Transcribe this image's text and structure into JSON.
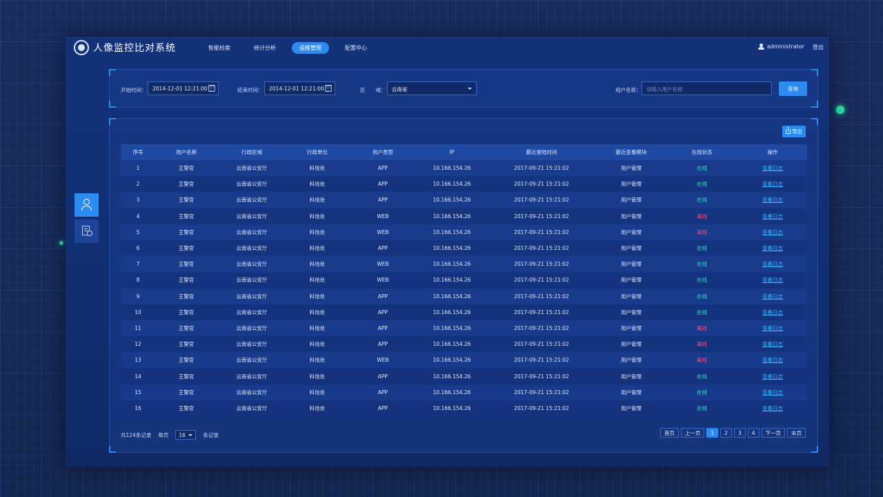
{
  "app": {
    "title": "人像监控比对系统"
  },
  "nav": {
    "items": [
      {
        "label": "智能检索",
        "active": false
      },
      {
        "label": "统计分析",
        "active": false
      },
      {
        "label": "运维管理",
        "active": true
      },
      {
        "label": "配置中心",
        "active": false
      }
    ]
  },
  "user": {
    "name": "administrator",
    "logout_label": "登出"
  },
  "filters": {
    "start_label": "开始时间：",
    "start_value": "2014-12-01  12:21:00",
    "end_label": "结束时间：",
    "end_value": "2014-12-01  12:21:00",
    "region_label": "区　　域：",
    "region_value": "云南省",
    "username_label": "用户名称：",
    "username_placeholder": "请输入用户名称",
    "query_label": "查询"
  },
  "table": {
    "export_label": "导出",
    "columns": [
      "序号",
      "用户名称",
      "行政区域",
      "行政单位",
      "用户类型",
      "IP",
      "最近登陆时间",
      "最近查看模块",
      "在线状态",
      "操作"
    ],
    "rows": [
      {
        "no": "1",
        "name": "王警官",
        "region": "云南省公安厅",
        "unit": "科信处",
        "type": "APP",
        "ip": "10.166.154.26",
        "time": "2017-09-21  15:21:02",
        "module": "用户管理",
        "status": "在线",
        "action": "查看日志"
      },
      {
        "no": "2",
        "name": "王警官",
        "region": "云南省公安厅",
        "unit": "科信处",
        "type": "APP",
        "ip": "10.166.154.26",
        "time": "2017-09-21  15:21:02",
        "module": "用户管理",
        "status": "在线",
        "action": "查看日志"
      },
      {
        "no": "3",
        "name": "王警官",
        "region": "云南省公安厅",
        "unit": "科信处",
        "type": "APP",
        "ip": "10.166.154.26",
        "time": "2017-09-21  15:21:02",
        "module": "用户管理",
        "status": "在线",
        "action": "查看日志"
      },
      {
        "no": "4",
        "name": "王警官",
        "region": "云南省公安厅",
        "unit": "科信处",
        "type": "WEB",
        "ip": "10.166.154.26",
        "time": "2017-09-21  15:21:02",
        "module": "用户管理",
        "status": "离线",
        "action": "查看日志"
      },
      {
        "no": "5",
        "name": "王警官",
        "region": "云南省公安厅",
        "unit": "科信处",
        "type": "WEB",
        "ip": "10.166.154.26",
        "time": "2017-09-21  15:21:02",
        "module": "用户管理",
        "status": "离线",
        "action": "查看日志"
      },
      {
        "no": "6",
        "name": "王警官",
        "region": "云南省公安厅",
        "unit": "科信处",
        "type": "APP",
        "ip": "10.166.154.26",
        "time": "2017-09-21  15:21:02",
        "module": "用户管理",
        "status": "在线",
        "action": "查看日志"
      },
      {
        "no": "7",
        "name": "王警官",
        "region": "云南省公安厅",
        "unit": "科信处",
        "type": "WEB",
        "ip": "10.166.154.26",
        "time": "2017-09-21  15:21:02",
        "module": "用户管理",
        "status": "在线",
        "action": "查看日志"
      },
      {
        "no": "8",
        "name": "王警官",
        "region": "云南省公安厅",
        "unit": "科信处",
        "type": "WEB",
        "ip": "10.166.154.26",
        "time": "2017-09-21  15:21:02",
        "module": "用户管理",
        "status": "在线",
        "action": "查看日志"
      },
      {
        "no": "9",
        "name": "王警官",
        "region": "云南省公安厅",
        "unit": "科信处",
        "type": "APP",
        "ip": "10.166.154.26",
        "time": "2017-09-21  15:21:02",
        "module": "用户管理",
        "status": "在线",
        "action": "查看日志"
      },
      {
        "no": "10",
        "name": "王警官",
        "region": "云南省公安厅",
        "unit": "科信处",
        "type": "APP",
        "ip": "10.166.154.26",
        "time": "2017-09-21  15:21:02",
        "module": "用户管理",
        "status": "在线",
        "action": "查看日志"
      },
      {
        "no": "11",
        "name": "王警官",
        "region": "云南省公安厅",
        "unit": "科信处",
        "type": "APP",
        "ip": "10.166.154.26",
        "time": "2017-09-21  15:21:02",
        "module": "用户管理",
        "status": "离线",
        "action": "查看日志"
      },
      {
        "no": "12",
        "name": "王警官",
        "region": "云南省公安厅",
        "unit": "科信处",
        "type": "APP",
        "ip": "10.166.154.26",
        "time": "2017-09-21  15:21:02",
        "module": "用户管理",
        "status": "离线",
        "action": "查看日志"
      },
      {
        "no": "13",
        "name": "王警官",
        "region": "云南省公安厅",
        "unit": "科信处",
        "type": "WEB",
        "ip": "10.166.154.26",
        "time": "2017-09-21  15:21:02",
        "module": "用户管理",
        "status": "离线",
        "action": "查看日志"
      },
      {
        "no": "14",
        "name": "王警官",
        "region": "云南省公安厅",
        "unit": "科信处",
        "type": "APP",
        "ip": "10.166.154.26",
        "time": "2017-09-21  15:21:02",
        "module": "用户管理",
        "status": "在线",
        "action": "查看日志"
      },
      {
        "no": "15",
        "name": "王警官",
        "region": "云南省公安厅",
        "unit": "科信处",
        "type": "APP",
        "ip": "10.166.154.26",
        "time": "2017-09-21  15:21:02",
        "module": "用户管理",
        "status": "在线",
        "action": "查看日志"
      },
      {
        "no": "16",
        "name": "王警官",
        "region": "云南省公安厅",
        "unit": "科信处",
        "type": "APP",
        "ip": "10.166.154.26",
        "time": "2017-09-21  15:21:02",
        "module": "用户管理",
        "status": "在线",
        "action": "查看日志"
      }
    ]
  },
  "footer": {
    "total_label": "共124条记录",
    "per_page_label": "每页",
    "per_page_value": "16",
    "records_label": "条记录"
  },
  "pager": {
    "first": "首页",
    "prev": "上一页",
    "pages": [
      "1",
      "2",
      "3",
      "4"
    ],
    "current": "1",
    "next": "下一页",
    "last": "末页"
  },
  "colors": {
    "accent": "#2c8bf0",
    "online": "#30e4c0",
    "offline": "#ff4d7a",
    "link": "#35b4ff"
  }
}
